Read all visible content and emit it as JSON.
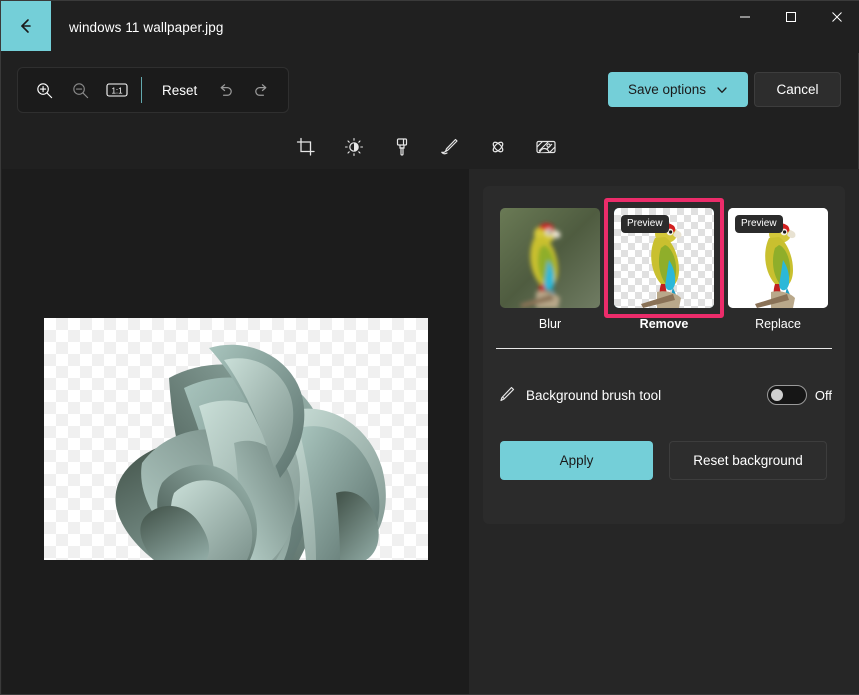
{
  "window": {
    "document_title": "windows 11 wallpaper.jpg",
    "back_label": "Back",
    "minimize_label": "Minimize",
    "maximize_label": "Maximize",
    "close_label": "Close",
    "accent_color": "#74cfd8",
    "background_color": "#202020"
  },
  "toolbar": {
    "zoom_in": "zoom-in",
    "zoom_out": "zoom-out",
    "actual_size": "1:1",
    "reset_label": "Reset",
    "undo": "undo",
    "redo": "redo"
  },
  "header_actions": {
    "save_label": "Save options",
    "cancel_label": "Cancel"
  },
  "tool_tabs": [
    {
      "name": "crop",
      "label": "Crop",
      "active": false
    },
    {
      "name": "adjustment",
      "label": "Adjustment",
      "active": false
    },
    {
      "name": "filter",
      "label": "Filter",
      "active": false
    },
    {
      "name": "markup",
      "label": "Markup",
      "active": false
    },
    {
      "name": "erase",
      "label": "Erase",
      "active": false
    },
    {
      "name": "background",
      "label": "Background",
      "active": true
    }
  ],
  "background_panel": {
    "options": [
      {
        "label": "Blur",
        "badge": "",
        "selected": false,
        "annotated": false
      },
      {
        "label": "Remove",
        "badge": "Preview",
        "selected": true,
        "annotated": true
      },
      {
        "label": "Replace",
        "badge": "Preview",
        "selected": false,
        "annotated": false
      }
    ],
    "brush_tool_label": "Background brush tool",
    "brush_toggle_state": "Off",
    "apply_label": "Apply",
    "reset_label": "Reset background",
    "annotation_color": "#ec2c6a",
    "selection_color": "#58c8d2"
  },
  "canvas": {
    "image_name": "windows 11 wallpaper.jpg",
    "transparency": "checkerboard"
  }
}
